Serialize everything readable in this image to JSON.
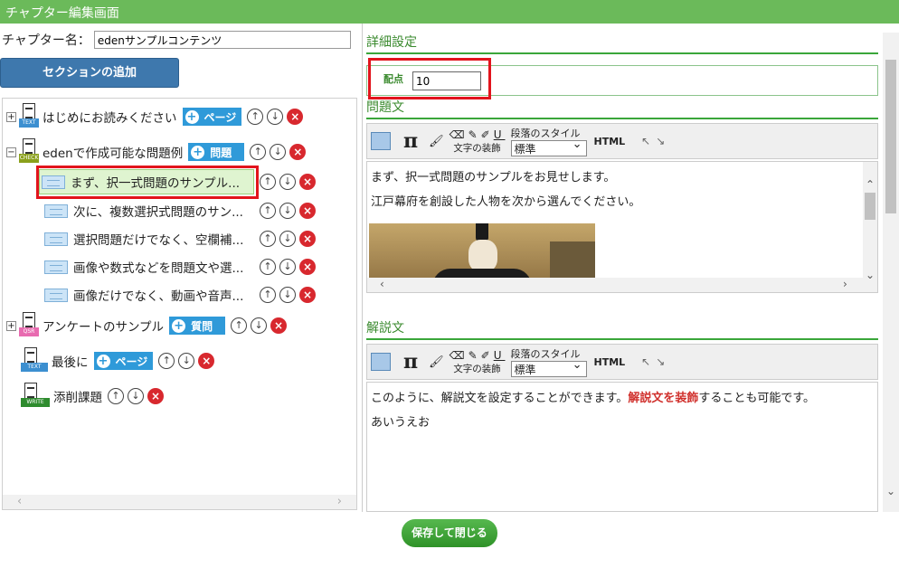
{
  "window": {
    "title": "チャプター編集画面"
  },
  "chapter": {
    "name_label": "チャプター名：",
    "name_value": "edenサンプルコンテンツ"
  },
  "add_section_label": "セクションの追加",
  "tree": {
    "items": [
      {
        "label": "はじめにお読みください",
        "type_tag": "TEXT",
        "button": "ページ"
      },
      {
        "label": "edenで作成可能な問題例",
        "type_tag": "CHECK",
        "button": "問題"
      },
      {
        "label": "アンケートのサンプル",
        "type_tag": "QSR",
        "button": "質問"
      },
      {
        "label": "最後に",
        "type_tag": "TEXT",
        "button": "ページ"
      },
      {
        "label": "添削課題",
        "type_tag": "WRITE"
      }
    ],
    "questions": [
      "まず、択一式問題のサンプル...",
      "次に、複数選択式問題のサン...",
      "選択問題だけでなく、空欄補...",
      "画像や数式などを問題文や選...",
      "画像だけでなく、動画や音声..."
    ]
  },
  "detail": {
    "title": "詳細設定",
    "score_label": "配点",
    "score_value": "10"
  },
  "question_section": {
    "title": "問題文",
    "line1": "まず、択一式問題のサンプルをお見せします。",
    "line2": "江戸幕府を創設した人物を次から選んでください。"
  },
  "explanation_section": {
    "title": "解説文",
    "line1_pre": "このように、解説文を設定することができます。",
    "line1_em": "解説文を装飾",
    "line1_post": "することも可能です。",
    "line2": "あいうえお"
  },
  "toolbar": {
    "pi": "π",
    "decoration_label": "文字の装飾",
    "underline": "U",
    "paragraph_style_label": "段落のスタイル",
    "paragraph_style_value": "標準",
    "html_label": "HTML"
  },
  "save_button": "保存して閉じる",
  "colors": {
    "title_bar": "#6bba5a",
    "accent_blue": "#2f9ad9",
    "delete_red": "#d8282e",
    "section_green": "#3a8a2e"
  }
}
